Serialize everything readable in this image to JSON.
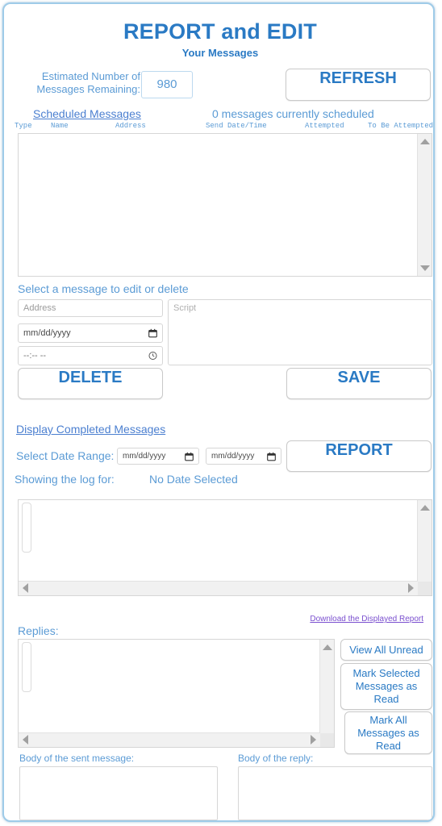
{
  "header": {
    "title": "REPORT and EDIT",
    "subtitle": "Your Messages",
    "remaining_label": "Estimated Number of\nMessages Remaining:",
    "remaining_label_line1": "Estimated Number of",
    "remaining_label_line2": "Messages Remaining:",
    "remaining_value": "980",
    "refresh_label": "REFRESH"
  },
  "scheduled": {
    "link_label": "Scheduled Messages",
    "count_text": "0 messages currently scheduled",
    "columns": [
      "Type",
      "Name",
      "Address",
      "Send Date/Time",
      "Attempted",
      "To Be Attempted"
    ],
    "rows": []
  },
  "edit": {
    "section_label": "Select a message to edit or delete",
    "address_placeholder": "Address",
    "address_value": "",
    "date_placeholder": "mm/dd/yyyy",
    "date_value": "",
    "time_placeholder": "--:-- --",
    "time_value": "",
    "script_placeholder": "Script",
    "script_value": "",
    "delete_label": "DELETE",
    "save_label": "SAVE"
  },
  "report": {
    "display_completed_label": "Display Completed Messages",
    "date_range_label": "Select Date Range:",
    "date_from_placeholder": "mm/dd/yyyy",
    "date_from_value": "",
    "date_to_placeholder": "mm/dd/yyyy",
    "date_to_value": "",
    "report_label": "REPORT",
    "showing_label": "Showing the log for:",
    "showing_value": "No Date Selected",
    "log_value": "",
    "download_label": "Download the Displayed Report"
  },
  "replies": {
    "label": "Replies:",
    "list_value": "",
    "view_unread_label": "View All Unread",
    "mark_selected_label": "Mark Selected Messages as Read",
    "mark_all_label": "Mark All Messages as Read"
  },
  "bodies": {
    "sent_label": "Body of the sent message:",
    "sent_value": "",
    "reply_label": "Body of the reply:",
    "reply_value": ""
  },
  "colors": {
    "accent_blue": "#2a7ac4",
    "label_blue": "#5b9bd5",
    "link_blue": "#4b7fd0",
    "visited_link": "#7a4fcf",
    "page_border": "#9ecbe8"
  }
}
